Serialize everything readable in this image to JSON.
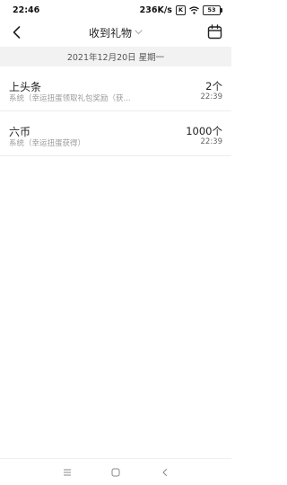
{
  "status_bar": {
    "time": "22:46",
    "network_speed": "236K/s",
    "sim_label": "K",
    "battery": "53"
  },
  "header": {
    "title": "收到礼物",
    "back_icon": "back-chevron-icon",
    "dropdown_icon": "chevron-down-icon",
    "calendar_icon": "calendar-icon"
  },
  "date_bar": {
    "date": "2021年12月20日 星期一"
  },
  "gifts": [
    {
      "title": "上头条",
      "subtitle": "系统（幸运扭蛋领取礼包奖励（获...",
      "amount": "2个",
      "time": "22:39"
    },
    {
      "title": "六币",
      "subtitle": "系统（幸运扭蛋获得）",
      "amount": "1000个",
      "time": "22:39"
    }
  ],
  "nav_bar": {
    "menu_icon": "menu-icon",
    "home_icon": "home-square-icon",
    "back_icon": "back-triangle-icon"
  },
  "colors": {
    "date_bar_bg": "#f2f2f2",
    "subtitle_text": "#9a9a9a"
  }
}
